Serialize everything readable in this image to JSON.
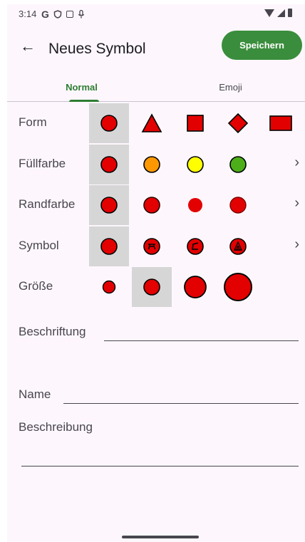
{
  "status_bar": {
    "time": "3:14",
    "google_glyph": "G"
  },
  "header": {
    "title": "Neues Symbol",
    "save_label": "Speichern",
    "back_icon": "←"
  },
  "tabs": [
    {
      "label": "Normal",
      "active": true
    },
    {
      "label": "Emoji",
      "active": false
    }
  ],
  "rows": {
    "form": {
      "label": "Form",
      "selected_index": 0,
      "options": [
        "circle",
        "triangle",
        "square",
        "diamond",
        "rectangle"
      ]
    },
    "fill": {
      "label": "Füllfarbe",
      "selected_index": 0,
      "options": [
        "#e30000",
        "#ff9800",
        "#ffff00",
        "#4caf1a"
      ]
    },
    "border": {
      "label": "Randfarbe",
      "selected_index": 0
    },
    "symbol": {
      "label": "Symbol",
      "selected_index": 0,
      "options": [
        "none",
        "picnic-table-icon",
        "lean-to-icon",
        "tent-icon"
      ]
    },
    "size": {
      "label": "Größe",
      "selected_index": 1
    }
  },
  "fields": {
    "caption": {
      "label": "Beschriftung",
      "value": ""
    },
    "name": {
      "label": "Name",
      "value": ""
    },
    "description": {
      "label": "Beschreibung",
      "value": ""
    }
  },
  "colors": {
    "accent": "#2e7d32",
    "save_button": "#3a8d3c",
    "marker_red": "#e30000",
    "selection_bg": "#d6d6d6"
  },
  "chevron": "›"
}
